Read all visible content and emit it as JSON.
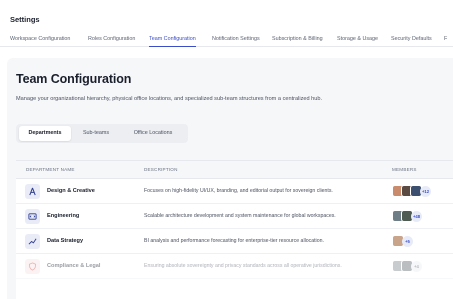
{
  "header": {
    "title": "Settings",
    "tabs": [
      {
        "label": "Workspace Configuration"
      },
      {
        "label": "Roles Configuration"
      },
      {
        "label": "Team Configuration"
      },
      {
        "label": "Notification Settings"
      },
      {
        "label": "Subscription & Billing"
      },
      {
        "label": "Storage & Usage"
      },
      {
        "label": "Security Defaults"
      },
      {
        "label": "F"
      }
    ],
    "active_tab": "Team Configuration"
  },
  "page": {
    "title": "Team Configuration",
    "subtitle": "Manage your organizational hierarchy, physical office locations, and specialized sub-team structures from a centralized hub."
  },
  "segmented": {
    "options": [
      {
        "label": "Departments"
      },
      {
        "label": "Sub-teams"
      },
      {
        "label": "Office Locations"
      }
    ],
    "selected": "Departments"
  },
  "table": {
    "columns": {
      "name": "DEPARTMENT NAME",
      "description": "DESCRIPTION",
      "members": "MEMBERS"
    },
    "rows": [
      {
        "name": "Design & Creative",
        "description": "Focuses on high-fidelity UI/UX, branding, and editorial output for sovereign clients.",
        "icon": "compass-icon",
        "more": "+12"
      },
      {
        "name": "Engineering",
        "description": "Scalable architecture development and system maintenance for global workspaces.",
        "icon": "code-window-icon",
        "more": "+48"
      },
      {
        "name": "Data Strategy",
        "description": "BI analysis and performance forecasting for enterprise-tier resource allocation.",
        "icon": "line-chart-icon",
        "more": "+5"
      },
      {
        "name": "Compliance & Legal",
        "description": "Ensuring absolute sovereignty and privacy standards across all operative jurisdictions.",
        "icon": "shield-icon",
        "more": "+4"
      }
    ]
  },
  "colors": {
    "accent": "#3b4ec8",
    "panel_bg": "#f6f7f9",
    "text": "#1a1f2c",
    "muted": "#4a5060",
    "compliance_icon": "#d9534f"
  }
}
